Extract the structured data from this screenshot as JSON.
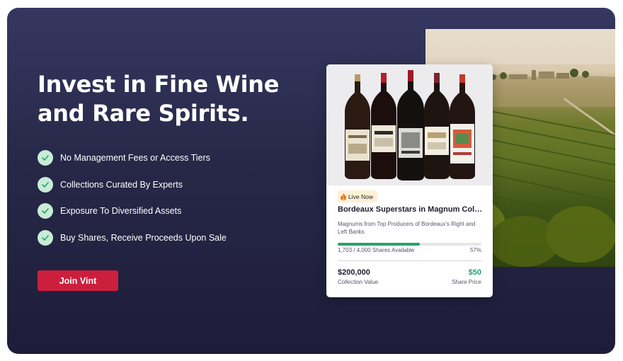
{
  "hero": {
    "headline": "Invest in Fine Wine and Rare Spirits.",
    "features": [
      "No Management Fees or Access Tiers",
      "Collections Curated By Experts",
      "Exposure To Diversified Assets",
      "Buy Shares, Receive Proceeds Upon Sale"
    ],
    "cta_label": "Join Vint"
  },
  "card": {
    "badge": "Live Now",
    "badge_icon": "fire-icon",
    "title": "Bordeaux Superstars in Magnum Coll...",
    "description": "Magnums from Top Producers of Bordeaux's Right and Left Banks",
    "shares_available": "1,703 / 4,000 Shares Available",
    "progress_percent": "57%",
    "progress_fraction": 0.57,
    "collection_value": "$200,000",
    "collection_value_label": "Collection Value",
    "share_price": "$50",
    "share_price_label": "Share Price"
  },
  "colors": {
    "background_top": "#353760",
    "background_bottom": "#1d1d3a",
    "cta": "#cc1f3d",
    "check_bg": "#c9ecd7",
    "check_mark": "#27a36b",
    "accent_green": "#27a36b",
    "badge_bg": "#fdf1d3"
  }
}
